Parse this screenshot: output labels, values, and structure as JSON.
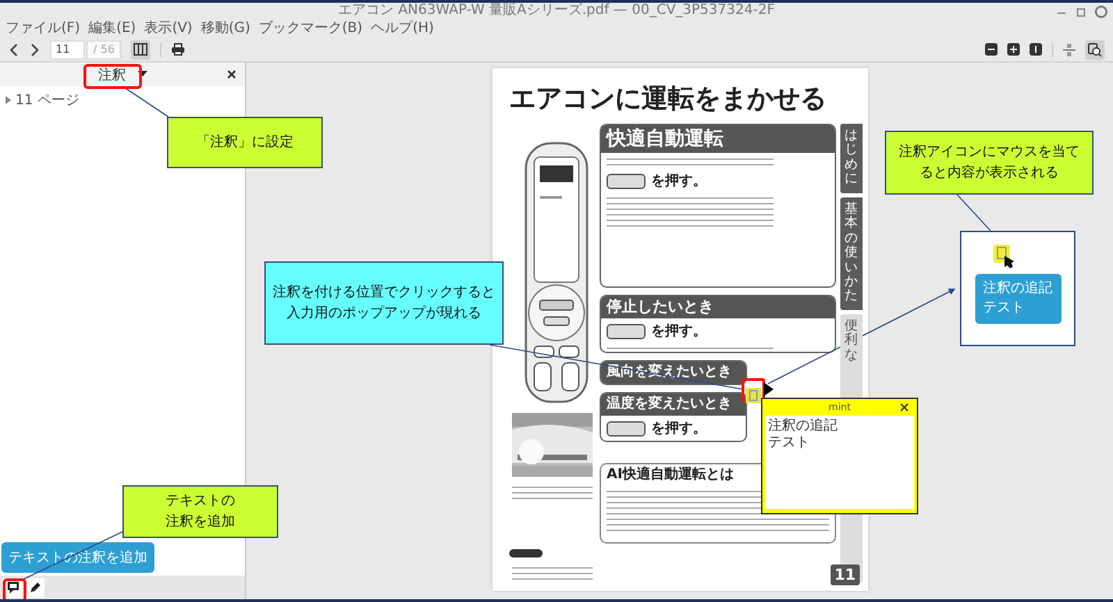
{
  "window": {
    "title": "エアコン AN63WAP-W 量販Aシリーズ.pdf — 00_CV_3P537324-2F"
  },
  "menu": [
    "ファイル(F)",
    "編集(E)",
    "表示(V)",
    "移動(G)",
    "ブックマーク(B)",
    "ヘルプ(H)"
  ],
  "toolbar": {
    "page": "11",
    "page_count": "/ 56",
    "sidebar_on": true
  },
  "sidebar": {
    "mode": "注釈",
    "tree": [
      {
        "label": "11 ページ",
        "expanded": false
      }
    ],
    "add_button": "テキストの注釈を追加"
  },
  "page": {
    "title": "エアコンに運転をまかせる",
    "sections": [
      {
        "kind": "main",
        "heading": "快適自動運転",
        "press": "を押す。"
      },
      {
        "kind": "main",
        "heading": "停止したいとき",
        "press": "を押す。"
      },
      {
        "kind": "small",
        "heading": "風向を変えたいとき"
      },
      {
        "kind": "small",
        "heading": "温度を変えたいとき",
        "press": "を押す。"
      },
      {
        "kind": "note",
        "heading": "AI快適自動運転とは"
      }
    ],
    "tabs": [
      {
        "label": "はじめに",
        "selected": false
      },
      {
        "label": "基本の使いかた",
        "selected": false
      },
      {
        "label": "便利な",
        "selected": true
      }
    ],
    "number": "11"
  },
  "annotation_popup": {
    "title": "mint",
    "lines": [
      "注釈の追記",
      "テスト"
    ]
  },
  "tooltip": {
    "lines": [
      "注釈の追記",
      "テスト"
    ]
  },
  "callouts": [
    {
      "lines": [
        "「注釈」に設定"
      ],
      "color": "#ccff33"
    },
    {
      "lines": [
        "注釈を付ける位置でクリックすると",
        "入力用のポップアップが現れる"
      ],
      "color": "#66ffff"
    },
    {
      "lines": [
        "テキストの",
        "注釈を追加"
      ],
      "color": "#ccff33"
    },
    {
      "lines": [
        "注釈アイコンにマウスを当て",
        "ると内容が表示される"
      ],
      "color": "#ccff33"
    }
  ]
}
